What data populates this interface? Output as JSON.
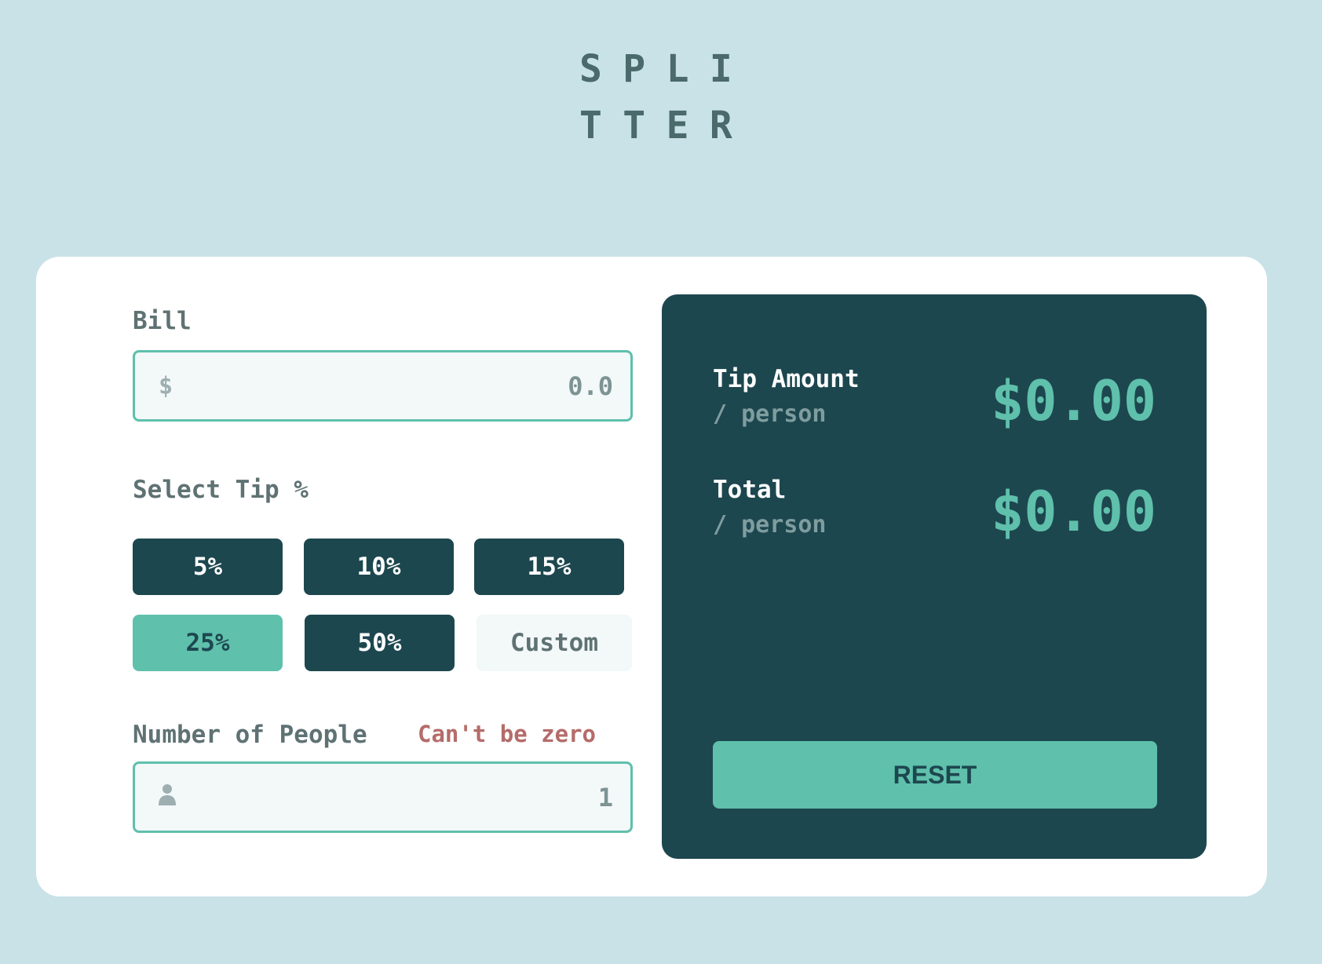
{
  "app": {
    "logo_line1": "SPLI",
    "logo_line2": "TTER"
  },
  "bill": {
    "label": "Bill",
    "prefix": "$",
    "value": "0.0"
  },
  "tip": {
    "label": "Select Tip %",
    "options": [
      "5%",
      "10%",
      "15%",
      "25%",
      "50%"
    ],
    "selected": "25%",
    "custom_placeholder": "Custom"
  },
  "people": {
    "label": "Number of People",
    "error": "Can't be zero",
    "value": "1",
    "icon": "person-icon"
  },
  "results": {
    "tip_label": "Tip Amount",
    "tip_sub": "/ person",
    "tip_value": "$0.00",
    "total_label": "Total",
    "total_sub": "/ person",
    "total_value": "$0.00",
    "reset_label": "RESET"
  },
  "colors": {
    "background": "#c9e2e7",
    "dark": "#1d474f",
    "accent": "#5fc0ac",
    "error": "#b46c6a"
  }
}
